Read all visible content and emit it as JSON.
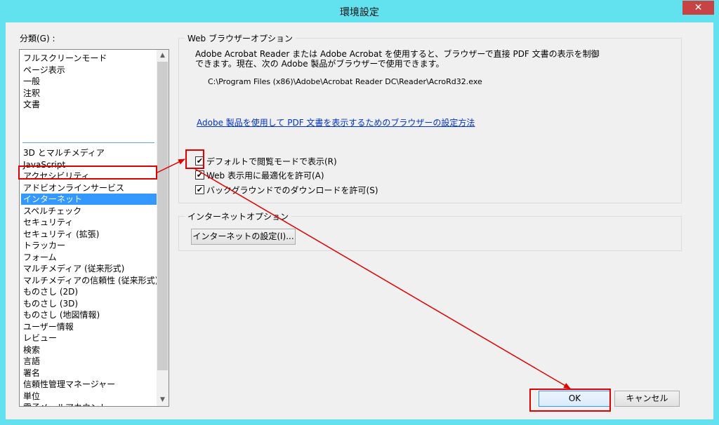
{
  "window": {
    "title": "環境設定",
    "close": "✕"
  },
  "category": {
    "label": "分類(G) :",
    "group_a": [
      "フルスクリーンモード",
      "ページ表示",
      "一般",
      "注釈",
      "文書"
    ],
    "group_b": [
      "3D とマルチメディア",
      "JavaScript",
      "アクセシビリティ",
      "アドビオンラインサービス",
      "インターネット",
      "スペルチェック",
      "セキュリティ",
      "セキュリティ (拡張)",
      "トラッカー",
      "フォーム",
      "マルチメディア (従来形式)",
      "マルチメディアの信頼性 (従来形式)",
      "ものさし (2D)",
      "ものさし (3D)",
      "ものさし (地図情報)",
      "ユーザー情報",
      "レビュー",
      "検索",
      "言語",
      "署名",
      "信頼性管理マネージャー",
      "単位",
      "電子メールアカウント"
    ],
    "selected": "インターネット"
  },
  "browser_options": {
    "title": "Web ブラウザーオプション",
    "desc_line1": "Adobe Acrobat Reader または Adobe Acrobat を使用すると、ブラウザーで直接 PDF 文書の表示を制御",
    "desc_line2": "できます。現在、次の Adobe 製品がブラウザーで使用できます。",
    "path": "C:\\Program Files (x86)\\Adobe\\Acrobat Reader DC\\Reader\\AcroRd32.exe",
    "link": "Adobe 製品を使用して PDF 文書を表示するためのブラウザーの設定方法",
    "checkboxes": [
      {
        "label": "デフォルトで閲覧モードで表示(R)",
        "checked": true
      },
      {
        "label": "Web 表示用に最適化を許可(A)",
        "checked": true
      },
      {
        "label": "バックグラウンドでのダウンロードを許可(S)",
        "checked": true
      }
    ],
    "check_mark": "✔"
  },
  "internet_options": {
    "title": "インターネットオプション",
    "button": "インターネットの設定(I)..."
  },
  "footer": {
    "ok": "OK",
    "cancel": "キャンセル"
  },
  "scroll": {
    "up": "▲",
    "down": "▼"
  },
  "colors": {
    "annotation": "#e00000",
    "selection": "#3399ff",
    "title_bar": "#62e2ee"
  }
}
